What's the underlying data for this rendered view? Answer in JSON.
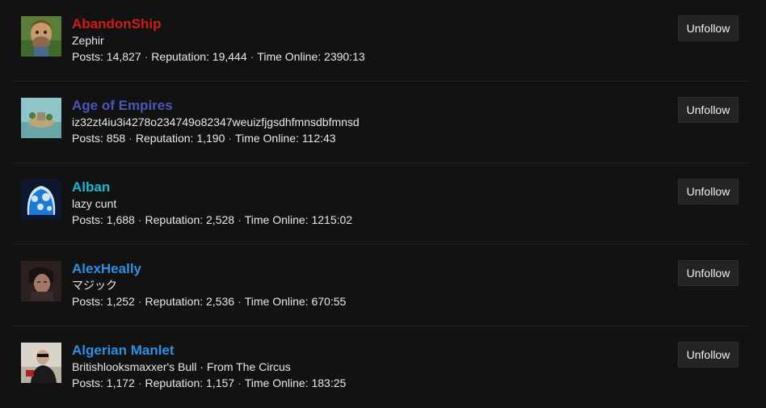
{
  "users": [
    {
      "name": "AbandonShip",
      "name_color": "#d11a1a",
      "subtitle": "Zephir",
      "posts_label": "Posts:",
      "posts": "14,827",
      "reputation_label": "Reputation:",
      "reputation": "19,444",
      "time_label": "Time Online:",
      "time_online": "2390:13",
      "avatar_icon": "avatar-cartoon-man",
      "button_label": "Unfollow"
    },
    {
      "name": "Age of Empires",
      "name_color": "#4a56b8",
      "subtitle": "iz32zt4iu3i4278o234749o82347weuizfjgsdhfmnsdbfmnsd",
      "posts_label": "Posts:",
      "posts": "858",
      "reputation_label": "Reputation:",
      "reputation": "1,190",
      "time_label": "Time Online:",
      "time_online": "112:43",
      "avatar_icon": "avatar-island-landscape",
      "button_label": "Unfollow"
    },
    {
      "name": "Alban",
      "name_color": "#19b9cf",
      "subtitle": "lazy cunt",
      "posts_label": "Posts:",
      "posts": "1,688",
      "reputation_label": "Reputation:",
      "reputation": "2,528",
      "time_label": "Time Online:",
      "time_online": "1215:02",
      "avatar_icon": "avatar-blue-blob",
      "button_label": "Unfollow"
    },
    {
      "name": "AlexHeally",
      "name_color": "#2f8fe0",
      "subtitle": "マジック",
      "posts_label": "Posts:",
      "posts": "1,252",
      "reputation_label": "Reputation:",
      "reputation": "2,536",
      "time_label": "Time Online:",
      "time_online": "670:55",
      "avatar_icon": "avatar-anime-character",
      "button_label": "Unfollow"
    },
    {
      "name": "Algerian Manlet",
      "name_color": "#2f8fe0",
      "subtitle": "Britishlooksmaxxer's Bull · From The Circus",
      "posts_label": "Posts:",
      "posts": "1,172",
      "reputation_label": "Reputation:",
      "reputation": "1,157",
      "time_label": "Time Online:",
      "time_online": "183:25",
      "avatar_icon": "avatar-person-photo",
      "button_label": "Unfollow"
    }
  ]
}
